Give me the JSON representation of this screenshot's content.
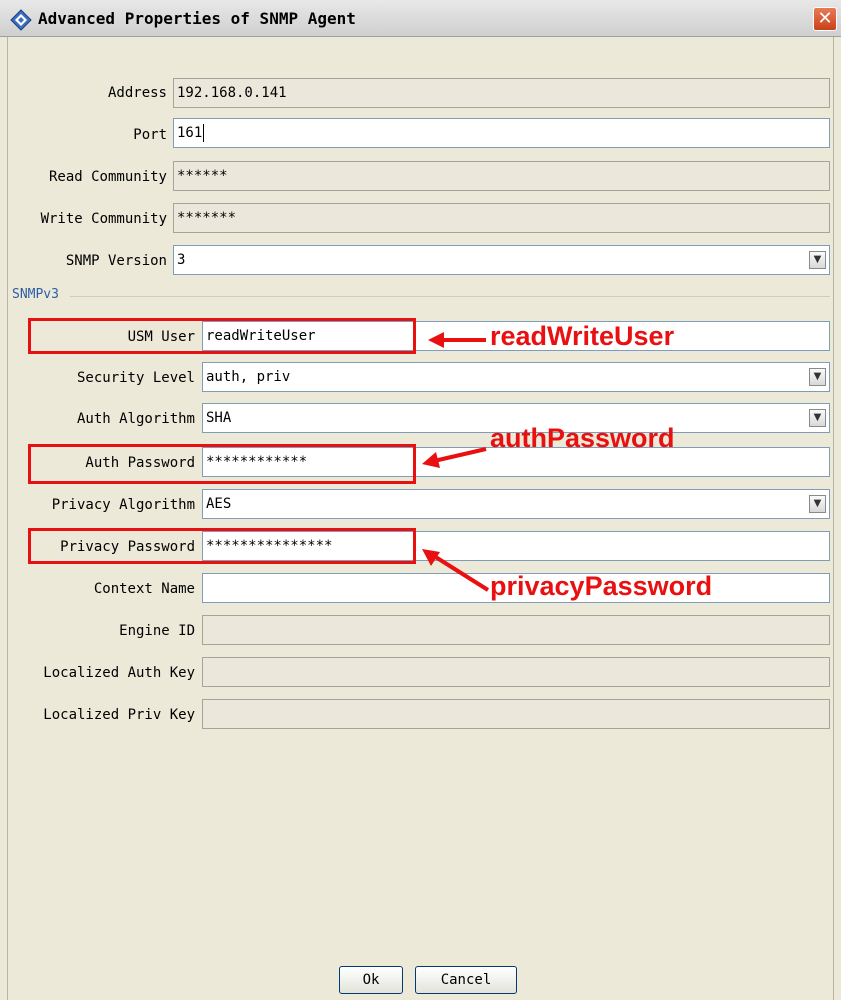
{
  "window": {
    "title": "Advanced Properties of SNMP Agent",
    "close_glyph": "✕"
  },
  "form": {
    "address": {
      "label": "Address",
      "value": "192.168.0.141"
    },
    "port": {
      "label": "Port",
      "value": "161"
    },
    "read_community": {
      "label": "Read Community",
      "value": "******"
    },
    "write_community": {
      "label": "Write Community",
      "value": "*******"
    },
    "snmp_version": {
      "label": "SNMP Version",
      "value": "3"
    }
  },
  "snmpv3": {
    "section_title": "SNMPv3",
    "usm_user": {
      "label": "USM User",
      "value": "readWriteUser"
    },
    "security_level": {
      "label": "Security Level",
      "value": "auth, priv"
    },
    "auth_algorithm": {
      "label": "Auth Algorithm",
      "value": "SHA"
    },
    "auth_password": {
      "label": "Auth Password",
      "value": "************"
    },
    "privacy_algorithm": {
      "label": "Privacy Algorithm",
      "value": "AES"
    },
    "privacy_password": {
      "label": "Privacy Password",
      "value": "***************"
    },
    "context_name": {
      "label": "Context Name",
      "value": ""
    },
    "engine_id": {
      "label": "Engine ID",
      "value": ""
    },
    "localized_auth_key": {
      "label": "Localized Auth Key",
      "value": ""
    },
    "localized_priv_key": {
      "label": "Localized Priv Key",
      "value": ""
    }
  },
  "annotations": {
    "usm_user": "readWriteUser",
    "auth_password": "authPassword",
    "privacy_password": "privacyPassword",
    "color": "#e81010"
  },
  "buttons": {
    "ok": "Ok",
    "cancel": "Cancel"
  },
  "icons": {
    "title": "diamond-icon",
    "dropdown": "chevron-down-icon",
    "close": "close-icon"
  }
}
